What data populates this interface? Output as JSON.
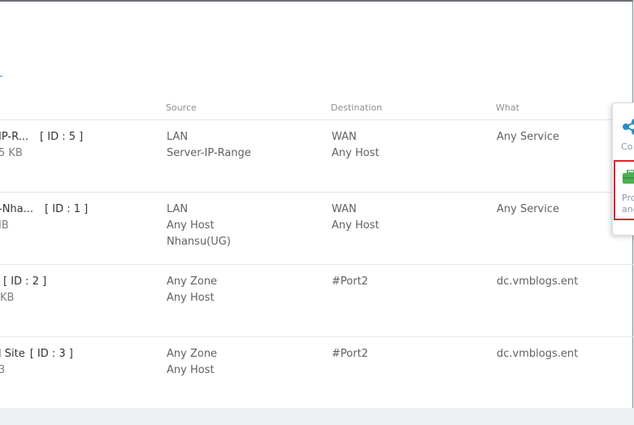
{
  "header": {
    "link_text": "r"
  },
  "table": {
    "columns": {
      "source": "Source",
      "destination": "Destination",
      "what": "What"
    },
    "rows": [
      {
        "name": "IP-R...",
        "id": "[ ID : 5 ]",
        "size": "5 KB",
        "source": [
          "LAN",
          "Server-IP-Range"
        ],
        "destination": [
          "WAN",
          "Any Host"
        ],
        "what": "Any Service"
      },
      {
        "name": "-Nha...",
        "id": "[ ID : 1 ]",
        "size": "IB",
        "source": [
          "LAN",
          "Any Host",
          "Nhansu(UG)"
        ],
        "destination": [
          "WAN",
          "Any Host"
        ],
        "what": "Any Service"
      },
      {
        "name": "",
        "id": "[ ID : 2 ]",
        "size": "KB",
        "source": [
          "Any Zone",
          "Any Host"
        ],
        "destination": [
          "#Port2"
        ],
        "what": "dc.vmblogs.ent"
      },
      {
        "name": "l Site",
        "id": "[ ID : 3 ]",
        "size": "3",
        "source": [
          "Any Zone",
          "Any Host"
        ],
        "destination": [
          "#Port2"
        ],
        "what": "dc.vmblogs.ent"
      }
    ]
  },
  "popup": {
    "item1": {
      "icon": "share-icon",
      "label": "Co"
    },
    "item2": {
      "icon": "briefcase-icon",
      "label_line1": "Pro",
      "label_line2": "and"
    },
    "colors": {
      "share": "#2a8cc7",
      "briefcase": "#4caf50",
      "highlight": "#d9262c"
    }
  }
}
